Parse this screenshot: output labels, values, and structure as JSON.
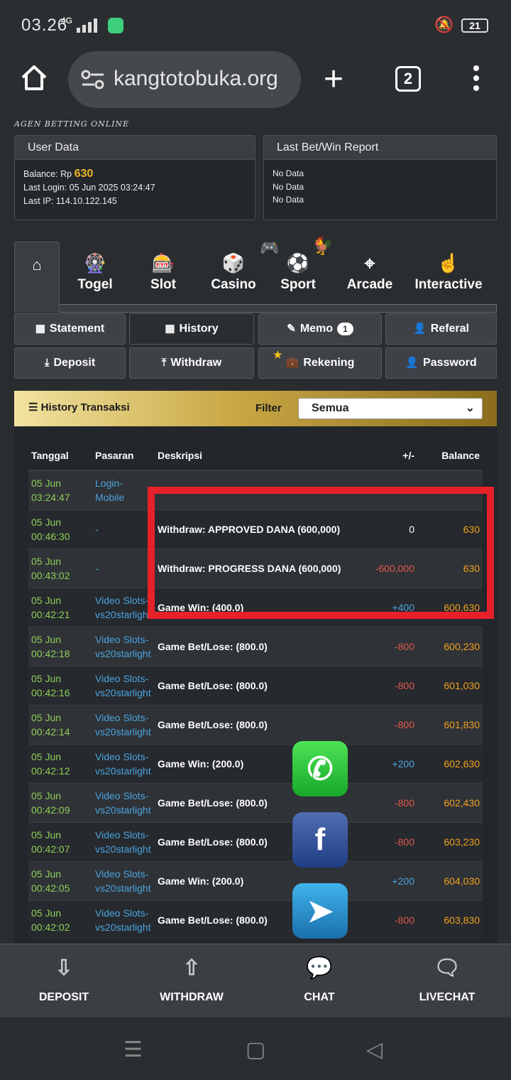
{
  "status": {
    "time": "03.26",
    "network": "4G",
    "battery": "21"
  },
  "browser": {
    "url": "kangtotobuka.org",
    "tab_count": "2"
  },
  "logo_tagline": "AGEN BETTING ONLINE",
  "user_data": {
    "title": "User Data",
    "balance_label": "Balance: Rp",
    "balance": "630",
    "last_login": "Last Login: 05 Jun 2025 03:24:47",
    "last_ip": "Last IP: 114.10.122.145"
  },
  "report": {
    "title": "Last Bet/Win Report",
    "lines": [
      "No Data",
      "No Data",
      "No Data"
    ]
  },
  "nav": {
    "togel": "Togel",
    "slot": "Slot",
    "casino": "Casino",
    "sport": "Sport",
    "arcade": "Arcade",
    "interactive": "Interactive"
  },
  "buttons": {
    "statement": "Statement",
    "history": "History",
    "memo": "Memo",
    "memo_badge": "1",
    "referal": "Referal",
    "deposit": "Deposit",
    "withdraw": "Withdraw",
    "rekening": "Rekening",
    "password": "Password"
  },
  "history": {
    "title": "History Transaksi",
    "filter_label": "Filter",
    "filter_value": "Semua",
    "columns": [
      "Tanggal",
      "Pasaran",
      "Deskripsi",
      "+/-",
      "Balance"
    ],
    "rows": [
      {
        "date": "05 Jun",
        "time": "03:24:47",
        "pasaran": "Login-Mobile",
        "desc": "",
        "amount": "",
        "balance": ""
      },
      {
        "date": "05 Jun",
        "time": "00:46:30",
        "pasaran": "-",
        "desc": "Withdraw: APPROVED DANA (600,000)",
        "amount": "0",
        "balance": "630"
      },
      {
        "date": "05 Jun",
        "time": "00:43:02",
        "pasaran": "-",
        "desc": "Withdraw: PROGRESS DANA (600,000)",
        "amount": "-600,000",
        "balance": "630"
      },
      {
        "date": "05 Jun",
        "time": "00:42:21",
        "pasaran": "Video Slots-vs20starlight",
        "desc": "Game Win: (400.0)",
        "amount": "+400",
        "balance": "600,630"
      },
      {
        "date": "05 Jun",
        "time": "00:42:18",
        "pasaran": "Video Slots-vs20starlight",
        "desc": "Game Bet/Lose: (800.0)",
        "amount": "-800",
        "balance": "600,230"
      },
      {
        "date": "05 Jun",
        "time": "00:42:16",
        "pasaran": "Video Slots-vs20starlight",
        "desc": "Game Bet/Lose: (800.0)",
        "amount": "-800",
        "balance": "601,030"
      },
      {
        "date": "05 Jun",
        "time": "00:42:14",
        "pasaran": "Video Slots-vs20starlight",
        "desc": "Game Bet/Lose: (800.0)",
        "amount": "-800",
        "balance": "601,830"
      },
      {
        "date": "05 Jun",
        "time": "00:42:12",
        "pasaran": "Video Slots-vs20starlight",
        "desc": "Game Win: (200.0)",
        "amount": "+200",
        "balance": "602,630"
      },
      {
        "date": "05 Jun",
        "time": "00:42:09",
        "pasaran": "Video Slots-vs20starlight",
        "desc": "Game Bet/Lose: (800.0)",
        "amount": "-800",
        "balance": "602,430"
      },
      {
        "date": "05 Jun",
        "time": "00:42:07",
        "pasaran": "Video Slots-vs20starlight",
        "desc": "Game Bet/Lose: (800.0)",
        "amount": "-800",
        "balance": "603,230"
      },
      {
        "date": "05 Jun",
        "time": "00:42:05",
        "pasaran": "Video Slots-vs20starlight",
        "desc": "Game Win: (200.0)",
        "amount": "+200",
        "balance": "604,030"
      },
      {
        "date": "05 Jun",
        "time": "00:42:02",
        "pasaran": "Video Slots-vs20starlight",
        "desc": "Game Bet/Lose: (800.0)",
        "amount": "-800",
        "balance": "603,830"
      }
    ]
  },
  "bottom_bar": {
    "deposit": "DEPOSIT",
    "withdraw": "WITHDRAW",
    "chat": "CHAT",
    "livechat": "LIVECHAT"
  },
  "colors": {
    "annotation_box": "#e8202a",
    "balance": "#f0b429",
    "date": "#8fcf5a",
    "link": "#4aa3df",
    "negative": "#e0584d"
  }
}
